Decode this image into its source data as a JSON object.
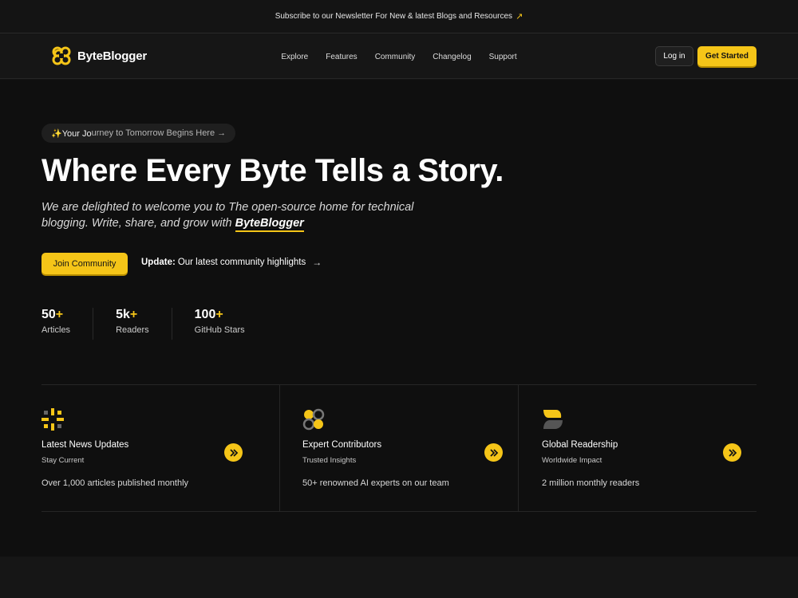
{
  "announcement": {
    "text": "Subscribe to our Newsletter For New & latest Blogs and Resources",
    "arrow": "↗"
  },
  "brand": {
    "name": "ByteBlogger",
    "logo_icon": "byteblogger-logo-icon",
    "accent": "#f5c518"
  },
  "nav": {
    "links": [
      "Explore",
      "Features",
      "Community",
      "Changelog",
      "Support"
    ],
    "login_label": "Log in",
    "get_started_label": "Get Started"
  },
  "hero": {
    "pill_first": "✨Your Jo",
    "pill_rest": "urney to Tomorrow Begins Here",
    "pill_arrow": "→",
    "headline": "Where Every Byte Tells a Story.",
    "subtext": "We are delighted to welcome you to The open-source home for technical blogging. Write, share, and grow with",
    "subtext_brand": "ByteBlogger",
    "join_label": "Join Community",
    "update_prefix": "Update:",
    "update_text": "Our latest community highlights",
    "update_arrow": "→"
  },
  "stats": [
    {
      "value": "50",
      "plus": "+",
      "label": "Articles"
    },
    {
      "value": "5k",
      "plus": "+",
      "label": "Readers"
    },
    {
      "value": "100",
      "plus": "+",
      "label": "GitHub Stars"
    }
  ],
  "features": [
    {
      "icon": "sparkle-icon",
      "title": "Latest News Updates",
      "subtitle": "Stay Current",
      "description": "Over 1,000 articles published monthly"
    },
    {
      "icon": "clover-icon",
      "title": "Expert Contributors",
      "subtitle": "Trusted Insights",
      "description": "50+ renowned AI experts on our team"
    },
    {
      "icon": "leaf-icon",
      "title": "Global Readership",
      "subtitle": "Worldwide Impact",
      "description": "2 million monthly readers"
    }
  ]
}
